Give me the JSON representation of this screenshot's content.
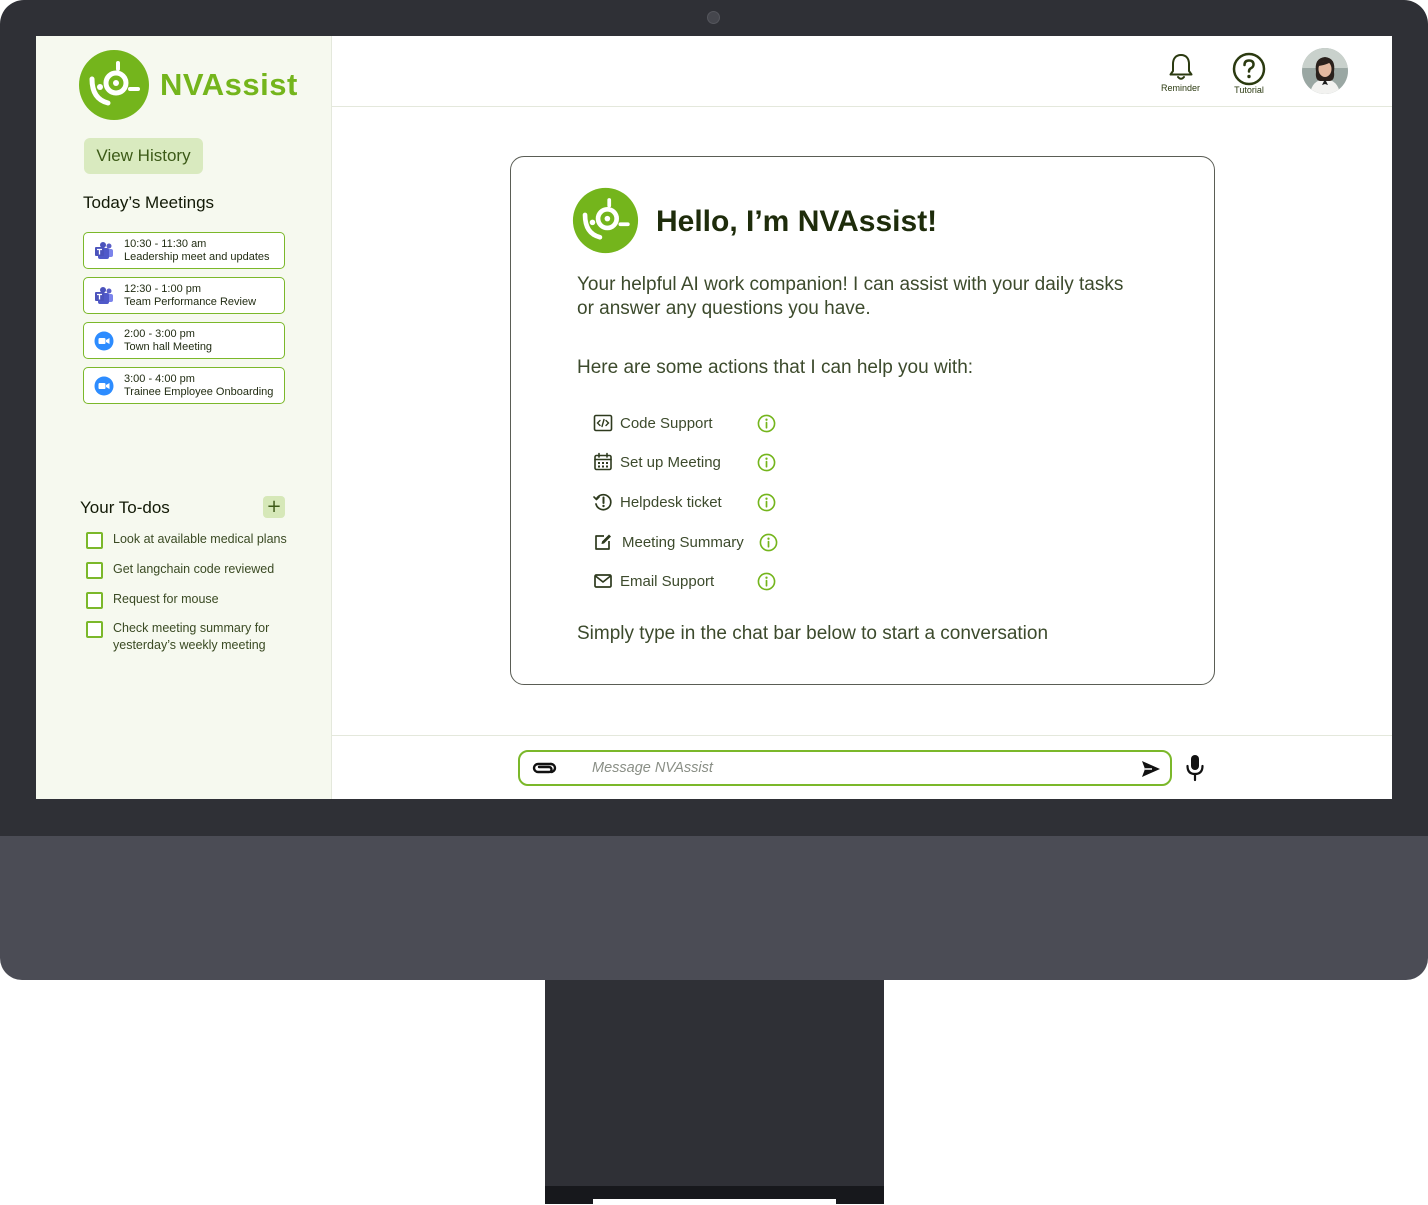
{
  "app": {
    "name": "NVAssist",
    "brand_color": "#74b51c",
    "accent_light": "#d9eabf"
  },
  "sidebar": {
    "history_button": "View History",
    "meetings_title": "Today’s Meetings",
    "meetings": [
      {
        "time": "10:30 - 11:30 am",
        "title": "Leadership meet and updates",
        "icon": "teams-icon"
      },
      {
        "time": "12:30 - 1:00 pm",
        "title": "Team Performance Review",
        "icon": "teams-icon"
      },
      {
        "time": "2:00 - 3:00 pm",
        "title": "Town hall Meeting",
        "icon": "zoom-icon"
      },
      {
        "time": "3:00 - 4:00 pm",
        "title": "Trainee Employee Onboarding",
        "icon": "zoom-icon"
      }
    ],
    "todos_title": "Your To-dos",
    "add_todo_label": "+",
    "todos": [
      {
        "text": "Look at available medical plans",
        "checked": false
      },
      {
        "text": "Get langchain code reviewed",
        "checked": false
      },
      {
        "text": "Request for mouse",
        "checked": false
      },
      {
        "text": "Check meeting summary for yesterday’s weekly meeting",
        "checked": false
      }
    ]
  },
  "topbar": {
    "reminder_label": "Reminder",
    "tutorial_label": "Tutorial",
    "reminder_icon": "bell-icon",
    "tutorial_icon": "question-circle-icon"
  },
  "welcome": {
    "title": "Hello, I’m NVAssist!",
    "intro": "Your helpful AI work companion! I can assist with your daily tasks or answer any questions you have.",
    "prompt": "Here are some actions that I can help you with:",
    "actions": [
      {
        "label": "Code Support",
        "icon": "code-icon"
      },
      {
        "label": "Set up Meeting",
        "icon": "calendar-icon"
      },
      {
        "label": "Helpdesk ticket",
        "icon": "alert-history-icon"
      },
      {
        "label": "Meeting Summary",
        "icon": "edit-note-icon"
      },
      {
        "label": "Email Support",
        "icon": "mail-icon"
      }
    ],
    "footer": "Simply type in the chat bar below to start a conversation"
  },
  "chat": {
    "placeholder": "Message NVAssist",
    "value": ""
  }
}
